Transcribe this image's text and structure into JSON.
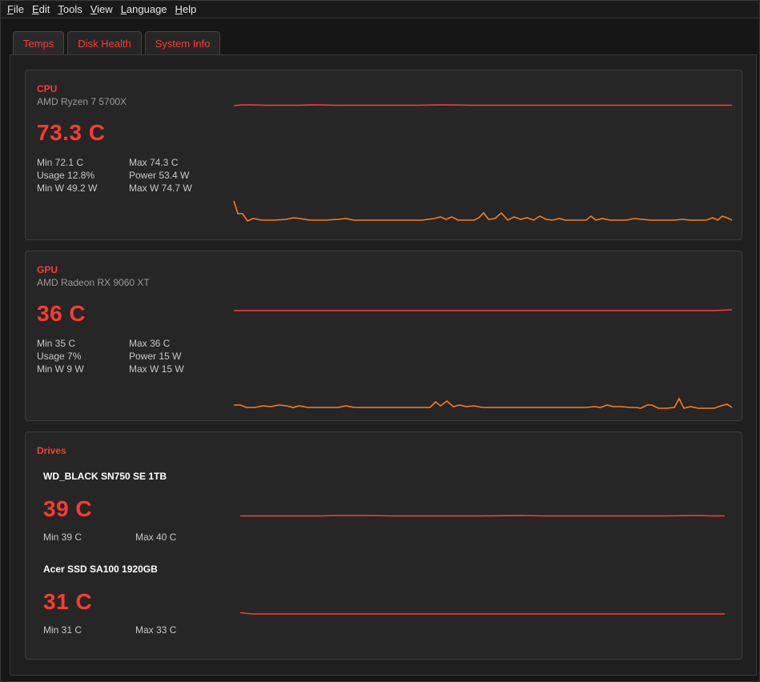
{
  "menu": {
    "file": "File",
    "edit": "Edit",
    "tools": "Tools",
    "view": "View",
    "language": "Language",
    "help": "Help"
  },
  "tabs": [
    {
      "label": "Temps"
    },
    {
      "label": "Disk Health"
    },
    {
      "label": "System Info"
    }
  ],
  "colors": {
    "accent": "#ff3b30",
    "temp_line": "#ff3b30",
    "power_line": "#ff7a1a"
  },
  "cpu": {
    "title": "CPU",
    "model": "AMD Ryzen 7 5700X",
    "temp": "73.3 C",
    "min": "Min 72.1 C",
    "max": "Max 74.3 C",
    "usage": "Usage 12.8%",
    "power": "Power 53.4 W",
    "min_w": "Min W 49.2 W",
    "max_w": "Max W 74.7 W"
  },
  "gpu": {
    "title": "GPU",
    "model": "AMD Radeon RX 9060 XT",
    "temp": "36 C",
    "min": "Min 35 C",
    "max": "Max 36 C",
    "usage": "Usage 7%",
    "power": "Power 15 W",
    "min_w": "Min W 9 W",
    "max_w": "Max W 15 W"
  },
  "drives": {
    "title": "Drives",
    "items": [
      {
        "name": "WD_BLACK SN750 SE 1TB",
        "temp": "39 C",
        "min": "Min 39 C",
        "max": "Max 40 C"
      },
      {
        "name": "Acer SSD SA100 1920GB",
        "temp": "31 C",
        "min": "Min 31 C",
        "max": "Max 33 C"
      }
    ]
  }
}
